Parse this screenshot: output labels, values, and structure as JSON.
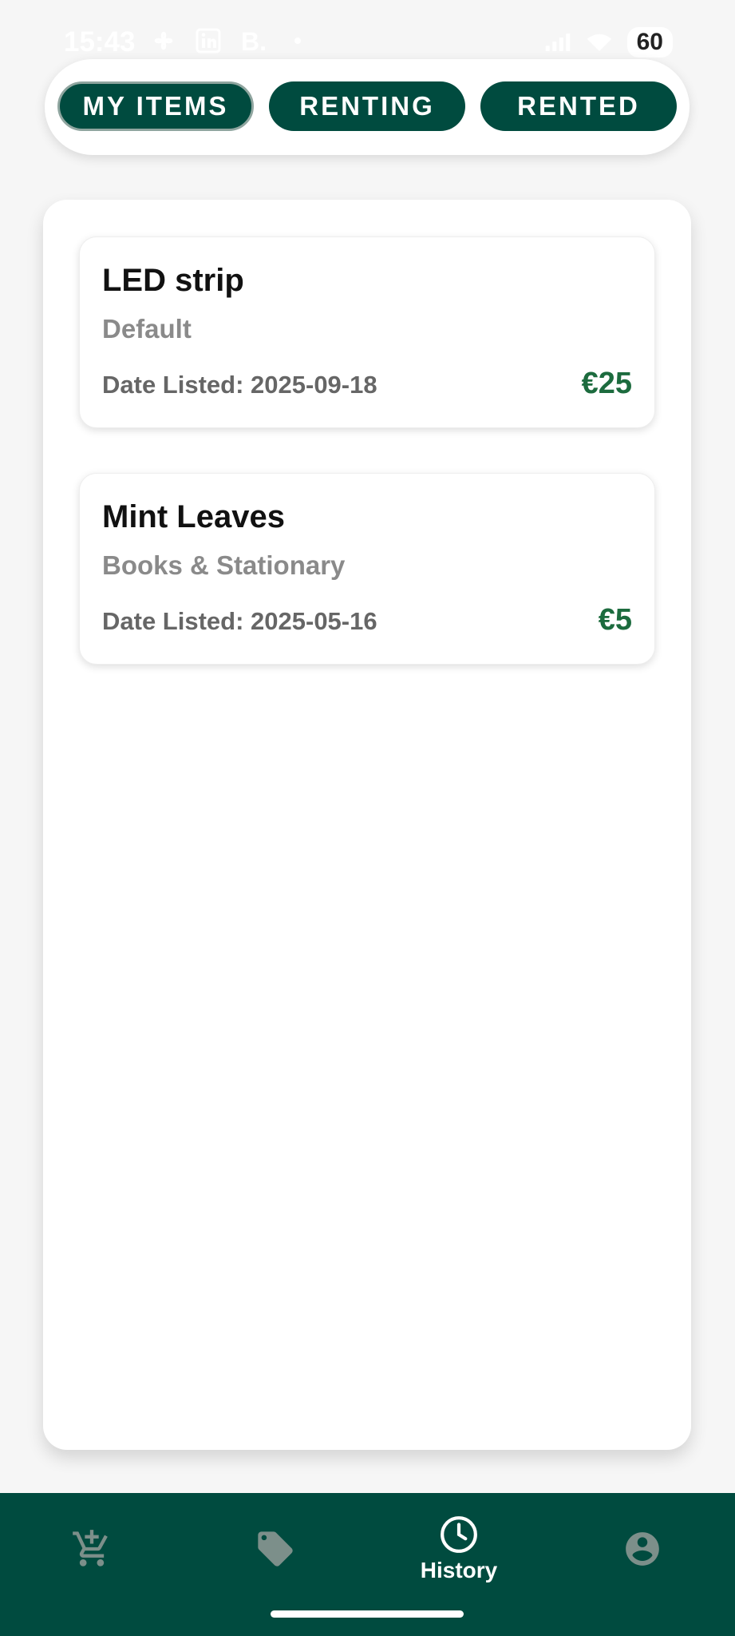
{
  "status_bar": {
    "time": "15:43",
    "battery": "60"
  },
  "tabs": [
    {
      "label": "MY ITEMS",
      "active": true
    },
    {
      "label": "RENTING",
      "active": false
    },
    {
      "label": "RENTED",
      "active": false
    }
  ],
  "items": [
    {
      "title": "LED strip",
      "category": "Default",
      "date": "Date Listed: 2025-09-18",
      "price": "€25"
    },
    {
      "title": "Mint Leaves",
      "category": "Books & Stationary",
      "date": "Date Listed: 2025-05-16",
      "price": "€5"
    }
  ],
  "bottom_nav": {
    "items": [
      {
        "icon": "add-to-cart-icon",
        "label": ""
      },
      {
        "icon": "tag-icon",
        "label": ""
      },
      {
        "icon": "clock-icon",
        "label": "History",
        "active": true
      },
      {
        "icon": "account-circle-icon",
        "label": ""
      }
    ]
  },
  "colors": {
    "primary": "#004b3f",
    "price": "#1c6b3e",
    "background": "#f6f6f6"
  }
}
